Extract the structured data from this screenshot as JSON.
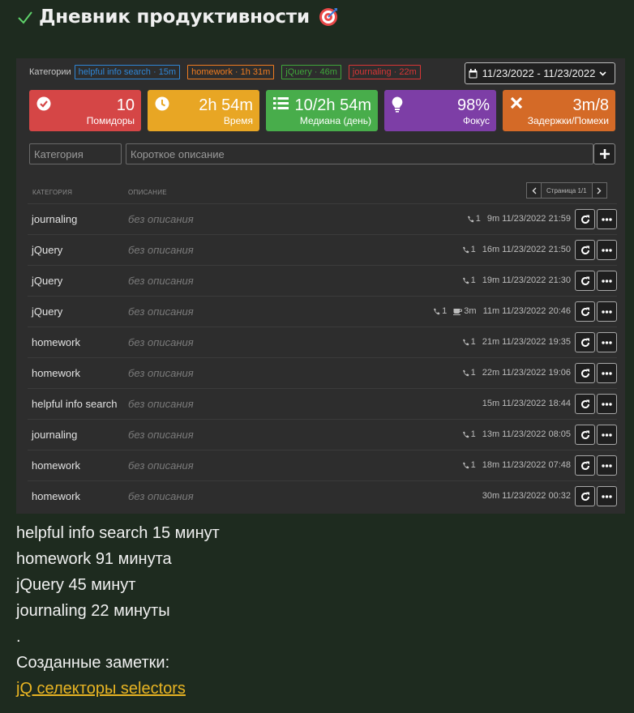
{
  "header": {
    "title": "Дневник продуктивности"
  },
  "categories": {
    "label": "Категории",
    "items": [
      {
        "label": "helpful info search · 15m",
        "color": "#2f86d6"
      },
      {
        "label": "homework · 1h 31m",
        "color": "#f07c20"
      },
      {
        "label": "jQuery · 46m",
        "color": "#3fa63a"
      },
      {
        "label": "journaling · 22m",
        "color": "#d93636"
      }
    ]
  },
  "date_range": "11/23/2022 - 11/23/2022",
  "stats": [
    {
      "value": "10",
      "label": "Помидоры",
      "color": "#d54646",
      "icon": "check-circle-icon"
    },
    {
      "value": "2h 54m",
      "label": "Время",
      "color": "#e8a624",
      "icon": "clock-icon"
    },
    {
      "value": "10/2h 54m",
      "label": "Медиана (день)",
      "color": "#48ad4b",
      "icon": "list-icon"
    },
    {
      "value": "98%",
      "label": "Фокус",
      "color": "#7d3ea6",
      "icon": "lightbulb-icon"
    },
    {
      "value": "3m/8",
      "label": "Задержки/Помехи",
      "color": "#d46a27",
      "icon": "x-icon"
    }
  ],
  "form": {
    "category_placeholder": "Категория",
    "description_placeholder": "Короткое описание"
  },
  "table": {
    "col_category": "КАТЕГОРИЯ",
    "col_description": "ОПИСАНИЕ",
    "page_info": "Страница 1/1"
  },
  "entries": [
    {
      "category": "journaling",
      "description": "без описания",
      "calls": "1",
      "breaks": "",
      "duration": "9m",
      "time": "11/23/2022 21:59"
    },
    {
      "category": "jQuery",
      "description": "без описания",
      "calls": "1",
      "breaks": "",
      "duration": "16m",
      "time": "11/23/2022 21:50"
    },
    {
      "category": "jQuery",
      "description": "без описания",
      "calls": "1",
      "breaks": "",
      "duration": "19m",
      "time": "11/23/2022 21:30"
    },
    {
      "category": "jQuery",
      "description": "без описания",
      "calls": "1",
      "breaks": "3m",
      "duration": "11m",
      "time": "11/23/2022 20:46"
    },
    {
      "category": "homework",
      "description": "без описания",
      "calls": "1",
      "breaks": "",
      "duration": "21m",
      "time": "11/23/2022 19:35"
    },
    {
      "category": "homework",
      "description": "без описания",
      "calls": "1",
      "breaks": "",
      "duration": "22m",
      "time": "11/23/2022 19:06"
    },
    {
      "category": "helpful info search",
      "description": "без описания",
      "calls": "",
      "breaks": "",
      "duration": "15m",
      "time": "11/23/2022 18:44"
    },
    {
      "category": "journaling",
      "description": "без описания",
      "calls": "1",
      "breaks": "",
      "duration": "13m",
      "time": "11/23/2022 08:05"
    },
    {
      "category": "homework",
      "description": "без описания",
      "calls": "1",
      "breaks": "",
      "duration": "18m",
      "time": "11/23/2022 07:48"
    },
    {
      "category": "homework",
      "description": "без описания",
      "calls": "",
      "breaks": "",
      "duration": "30m",
      "time": "11/23/2022 00:32"
    }
  ],
  "summary": {
    "lines": [
      "helpful info search 15 минут",
      "homework 91 минута",
      "jQuery 45 минут",
      "journaling 22 минуты",
      "."
    ],
    "notes_title": "Созданные заметки:",
    "notes": [
      "jQ селекторы selectors"
    ]
  }
}
